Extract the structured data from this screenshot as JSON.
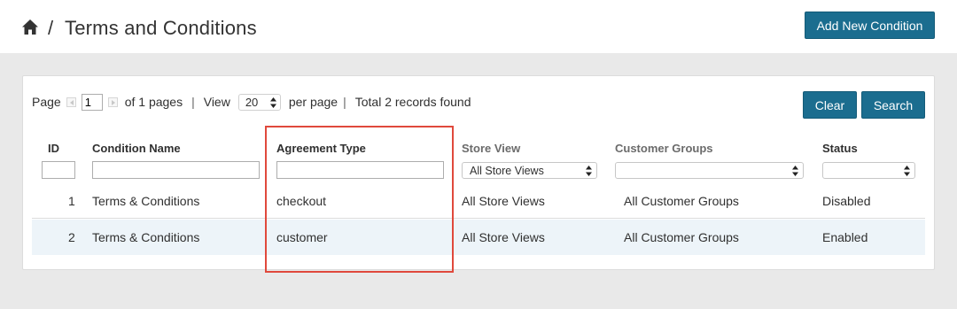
{
  "header": {
    "breadcrumb_separator": "/",
    "title": "Terms and Conditions",
    "add_button_label": "Add New Condition"
  },
  "pager": {
    "page_label": "Page",
    "current_page": "1",
    "of_pages_text": "of 1 pages",
    "sep1": "|",
    "view_label": "View",
    "per_page_value": "20",
    "per_page_text": "per page",
    "sep2": "|",
    "records_text": "Total 2 records found"
  },
  "actions": {
    "clear_label": "Clear",
    "search_label": "Search"
  },
  "columns": {
    "id": "ID",
    "condition_name": "Condition Name",
    "agreement_type": "Agreement Type",
    "store_view": "Store View",
    "customer_groups": "Customer Groups",
    "status": "Status"
  },
  "filters": {
    "store_view_selected": "All Store Views",
    "customer_groups_selected": "",
    "status_selected": ""
  },
  "rows": [
    {
      "id": "1",
      "name": "Terms & Conditions",
      "agreement_type": "checkout",
      "store_view": "All Store Views",
      "customer_groups": "All Customer Groups",
      "status": "Disabled"
    },
    {
      "id": "2",
      "name": "Terms & Conditions",
      "agreement_type": "customer",
      "store_view": "All Store Views",
      "customer_groups": "All Customer Groups",
      "status": "Enabled"
    }
  ],
  "colors": {
    "accent": "#1b6d8f",
    "highlight_border": "#e0493c",
    "alt_row": "#edf4f9"
  },
  "icons": {
    "home": "home-icon",
    "select": "select-arrows-icon"
  }
}
